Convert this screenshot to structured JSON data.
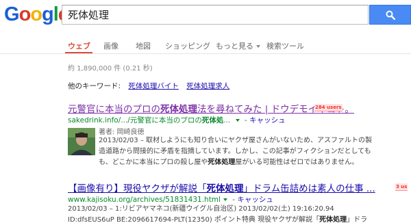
{
  "logo": "Google",
  "search": {
    "query": "死体処理"
  },
  "nav": {
    "tabs": [
      "ウェブ",
      "画像",
      "地図",
      "ショッピング",
      "もっと見る",
      "検索ツール"
    ]
  },
  "stats": "約 1,890,000 件 (0.21 秒)",
  "related": {
    "label": "他のキーワード:",
    "links": [
      "死体処理バイト",
      "死体処理求人"
    ]
  },
  "results": [
    {
      "title_pre": "元警官に本当のプロの",
      "title_bold": "死体処理",
      "title_post": "法を尋ねてみた | ドウデモイイコト。",
      "badge": "284 users",
      "url_pre": "sakedrink.info/.../元警官に本当のプロの",
      "url_bold": "死体処",
      "url_post": "...",
      "cache": "キャッシュ",
      "author": "著者: 岡崎良徳",
      "snippet": [
        {
          "pre": "2013/02/03 – 取材しようにも知り合いにヤクザ屋さんがいないため、アスファルトの製",
          "bold": "",
          "post": ""
        },
        {
          "pre": "造道路から問接的に矛盾を指摘しています。しかし、この記事がフィクションだとしても",
          "bold": "",
          "post": ""
        },
        {
          "pre": "も、どこかに本当にプロの殺し屋や",
          "bold": "死体処理",
          "post": "屋がいる可能性はゼロではありません。"
        }
      ]
    },
    {
      "title_pre": "【画像有り】現役ヤクザが解説「",
      "title_bold": "死体処理",
      "title_post": "」ドラム缶詰めは素人の仕事 ...",
      "badge": "3 us",
      "url_pre": "www.kajisoku.org/archives/51831431.html",
      "url_bold": "",
      "url_post": "",
      "cache": "キャッシュ",
      "snippet": [
        {
          "pre": "2013/02/03 – 1:リビアヤマネコ(新疆ウイグル自治区) 2013/02/02(土) 19:16:20.94",
          "bold": "",
          "post": ""
        },
        {
          "pre": "ID:dfsEUS6uP BE:2096617694-PLT(12350) ポイント特典 現役ヤクザが解説「",
          "bold": "死体処理",
          "post": "」ドラ"
        }
      ]
    }
  ],
  "colors": {
    "accent_red": "#dd4b39",
    "link_blue": "#1a0dab",
    "visited_purple": "#7b2fa8",
    "url_green": "#0a8a2e",
    "search_button": "#4a8af4"
  },
  "icons": [
    "search-icon",
    "author-photo"
  ]
}
